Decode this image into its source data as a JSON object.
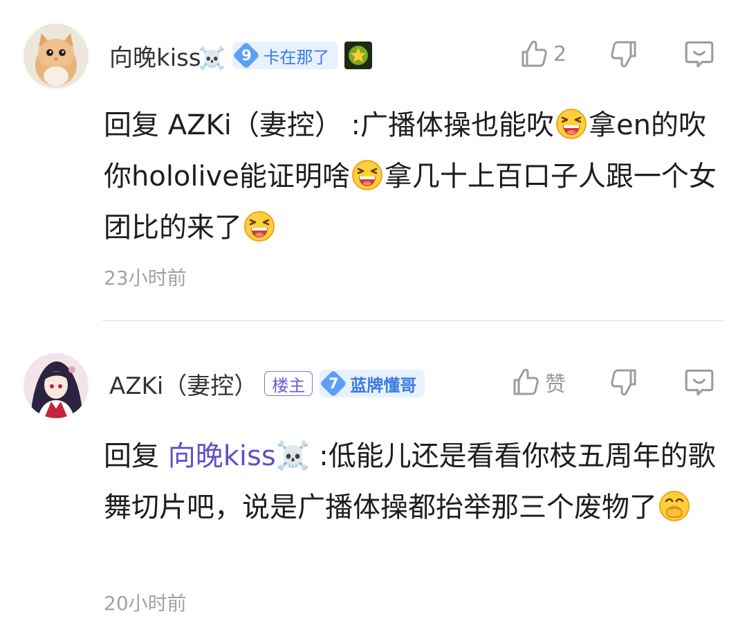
{
  "comments": [
    {
      "username": "向晚kiss",
      "name_suffix": "☠️",
      "level": "9",
      "level_title": "卡在那了",
      "like_count": "2",
      "body_prefix": "回复 ",
      "reply_to": "AZKi（妻控）",
      "reply_sep": " :",
      "body_segments": [
        "广播体操也能吹",
        "拿en的吹你hololive能证明啥",
        "拿几十上百口子人跟一个女团比的来了",
        ""
      ],
      "time": "23小时前"
    },
    {
      "username": "AZKi（妻控）",
      "op_badge": "楼主",
      "level": "7",
      "level_title": "蓝牌懂哥",
      "like_label": "赞",
      "body_prefix": "回复 ",
      "reply_to": "向晚kiss☠️",
      "reply_sep": " :",
      "body_segments": [
        "低能儿还是看看你枝五周年的歌舞切片吧，说是广播体操都抬举那三个废物了",
        ""
      ],
      "time": "20小时前"
    }
  ],
  "icons": {
    "like": "thumbs-up-icon",
    "dislike": "thumbs-down-icon",
    "reply": "comment-bubble-icon",
    "emoji_grin": "grinning-squint-emoji",
    "emoji_cover": "hand-over-mouth-emoji"
  },
  "colors": {
    "mention": "#5f51c9",
    "level_badge_bg": "#e7f1ff",
    "level_diamond": "#5ba0f5",
    "op_badge": "#6a5cd6",
    "meta_gray": "#a3a3a3"
  }
}
